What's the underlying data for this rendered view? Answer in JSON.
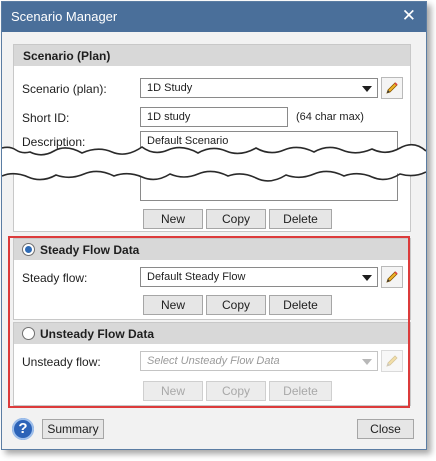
{
  "window": {
    "title": "Scenario Manager",
    "close_glyph": "✕"
  },
  "scenario_section": {
    "header": "Scenario (Plan)",
    "scenario_label": "Scenario (plan):",
    "scenario_value": "1D Study",
    "short_id_label": "Short ID:",
    "short_id_value": "1D study",
    "short_id_hint": "(64 char max)",
    "description_label": "Description:",
    "description_value": "Default Scenario",
    "buttons": {
      "new": "New",
      "copy": "Copy",
      "delete": "Delete"
    }
  },
  "steady_section": {
    "header": "Steady Flow Data",
    "selected": true,
    "flow_label": "Steady flow:",
    "flow_value": "Default Steady Flow",
    "buttons": {
      "new": "New",
      "copy": "Copy",
      "delete": "Delete"
    }
  },
  "unsteady_section": {
    "header": "Unsteady Flow Data",
    "selected": false,
    "flow_label": "Unsteady flow:",
    "flow_placeholder": "Select Unsteady Flow Data",
    "buttons": {
      "new": "New",
      "copy": "Copy",
      "delete": "Delete"
    }
  },
  "footer": {
    "help_glyph": "?",
    "summary": "Summary",
    "close": "Close"
  },
  "colors": {
    "title_bar": "#4a6f9a",
    "highlight_box": "#dc3b3b",
    "radio_selected": "#2f6bb5",
    "pencil": "#f0b429",
    "help": "#2c63b8"
  },
  "icons": {
    "edit": "pencil-icon",
    "dropdown": "chevron-down-icon",
    "close": "close-icon",
    "help": "help-icon"
  }
}
